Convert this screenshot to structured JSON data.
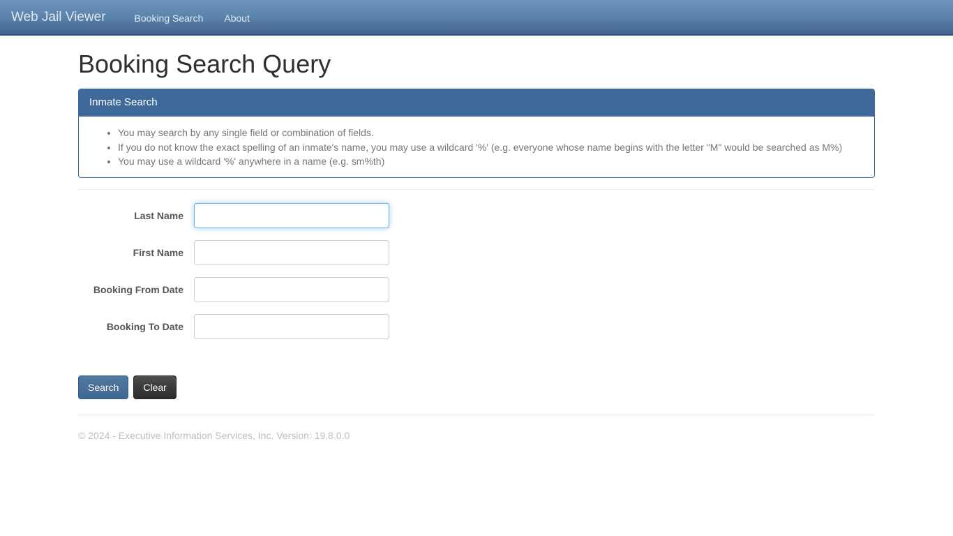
{
  "navbar": {
    "brand": "Web Jail Viewer",
    "links": [
      {
        "label": "Booking Search"
      },
      {
        "label": "About"
      }
    ]
  },
  "page": {
    "title": "Booking Search Query"
  },
  "panel": {
    "heading": "Inmate Search",
    "hints": [
      "You may search by any single field or combination of fields.",
      "If you do not know the exact spelling of an inmate's name, you may use a wildcard '%' (e.g. everyone whose name begins with the letter \"M\" would be searched as M%)",
      "You may use a wildcard '%' anywhere in a name (e.g. sm%th)"
    ]
  },
  "form": {
    "fields": [
      {
        "label": "Last Name",
        "value": "",
        "placeholder": "",
        "focused": true
      },
      {
        "label": "First Name",
        "value": "",
        "placeholder": "",
        "focused": false
      },
      {
        "label": "Booking From Date",
        "value": "",
        "placeholder": "",
        "focused": false
      },
      {
        "label": "Booking To Date",
        "value": "",
        "placeholder": "",
        "focused": false
      }
    ],
    "buttons": {
      "search_label": "Search",
      "clear_label": "Clear"
    }
  },
  "footer": {
    "text": "© 2024 - Executive Information Services, Inc. Version: 19.8.0.0"
  },
  "colors": {
    "navbar_top": "#6f96bd",
    "navbar_bottom": "#436590",
    "panel_header": "#40699b",
    "panel_border": "#3d6993",
    "focus_border": "#66afe9",
    "primary_button": "#4a7198",
    "default_button": "#3b3b3b",
    "label_text": "#555555",
    "hint_text": "#767676",
    "footer_text": "#bdbdbd"
  }
}
